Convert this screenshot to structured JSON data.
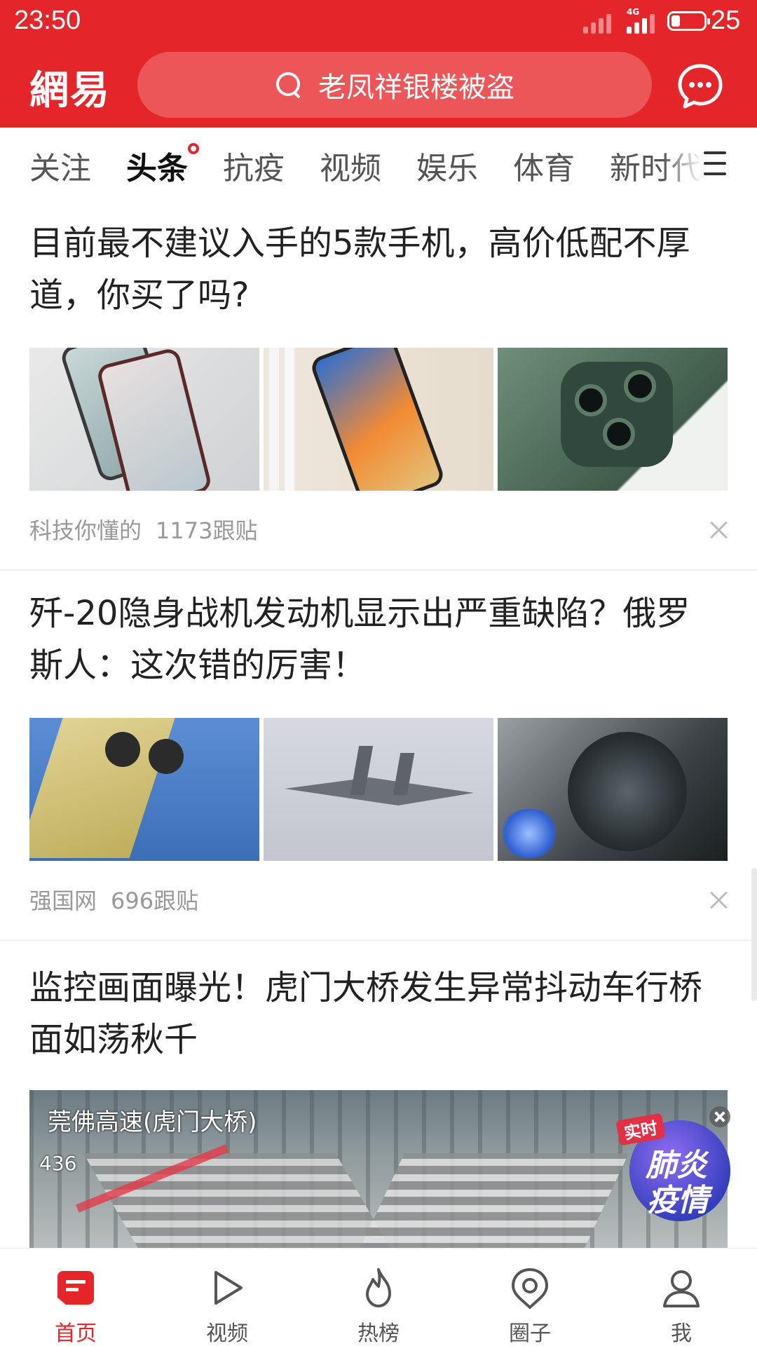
{
  "status_bar": {
    "time": "23:50",
    "network": "4G",
    "battery": "25"
  },
  "header": {
    "logo": "網易",
    "search_text": "老凤祥银楼被盗"
  },
  "tabs": [
    {
      "label": "关注"
    },
    {
      "label": "头条",
      "active": true,
      "has_dot": true
    },
    {
      "label": "抗疫"
    },
    {
      "label": "视频"
    },
    {
      "label": "娱乐"
    },
    {
      "label": "体育"
    },
    {
      "label": "新时代"
    }
  ],
  "articles": [
    {
      "title": "目前最不建议入手的5款手机，高价低配不厚道，你买了吗?",
      "source": "科技你懂的",
      "comments": "1173跟贴"
    },
    {
      "title": "歼-20隐身战机发动机显示出严重缺陷？俄罗斯人：这次错的厉害！",
      "source": "强国网",
      "comments": "696跟贴"
    },
    {
      "title": "监控画面曝光！虎门大桥发生异常抖动车行桥面如荡秋千",
      "video_overlay": "莞佛高速(虎门大桥)",
      "video_number": "436"
    }
  ],
  "badge": {
    "line1": "实时",
    "line2": "肺炎",
    "line3": "疫情"
  },
  "bottom_nav": [
    {
      "label": "首页",
      "icon": "home-icon",
      "active": true
    },
    {
      "label": "视频",
      "icon": "play-icon"
    },
    {
      "label": "热榜",
      "icon": "flame-icon"
    },
    {
      "label": "圈子",
      "icon": "circle-icon"
    },
    {
      "label": "我",
      "icon": "user-icon"
    }
  ],
  "colors": {
    "brand_red": "#e4262b",
    "search_bg": "#ec5659"
  }
}
